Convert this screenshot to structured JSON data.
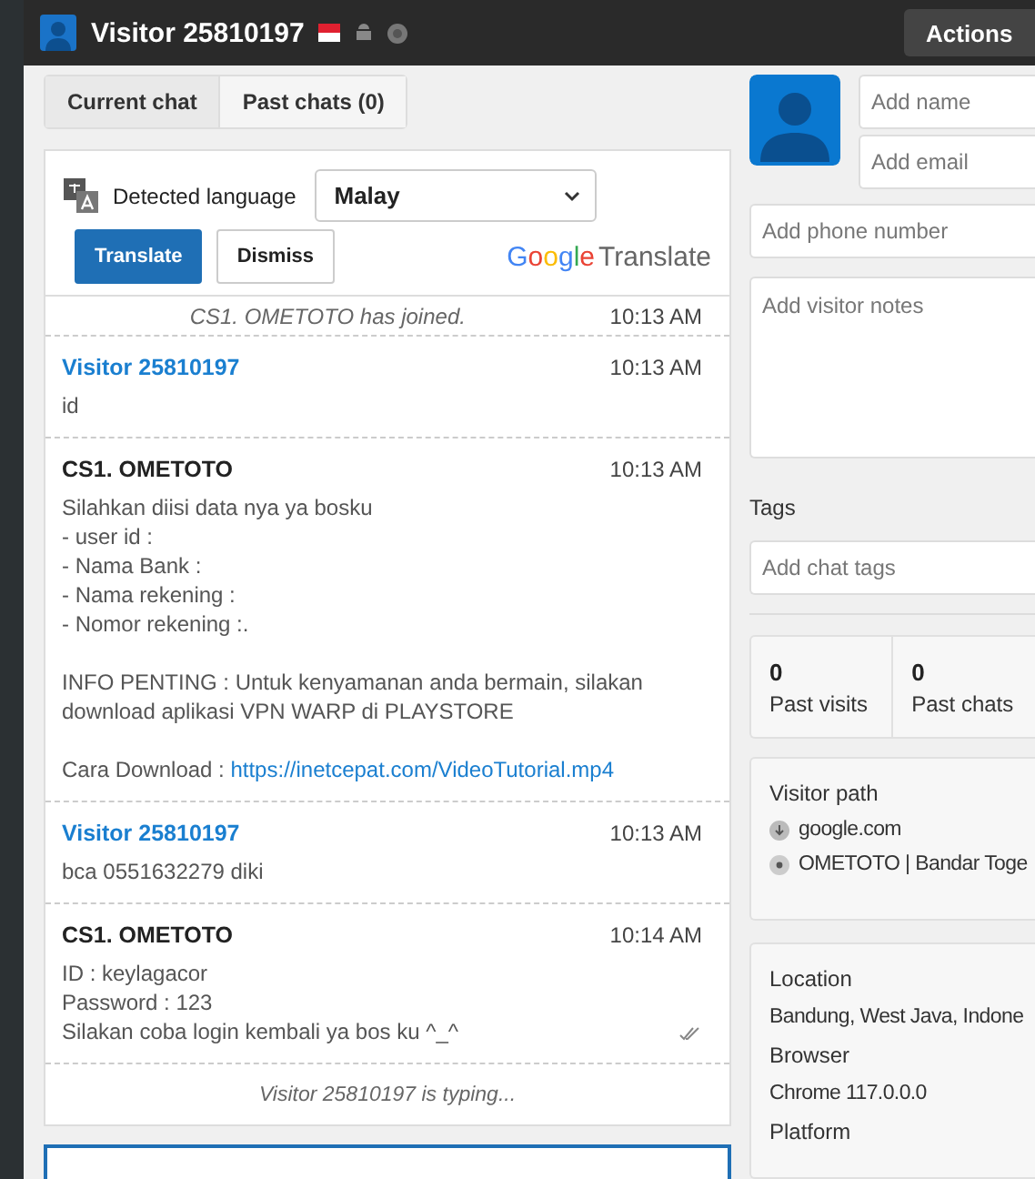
{
  "header": {
    "title": "Visitor 25810197",
    "actions": "Actions"
  },
  "tabs": [
    {
      "label": "Current chat",
      "selected": true
    },
    {
      "label": "Past chats (0)",
      "selected": false
    }
  ],
  "translate": {
    "label": "Detected language",
    "language": "Malay",
    "primary": "Translate",
    "secondary": "Dismiss",
    "brand_name": "Google",
    "brand_product": "Translate"
  },
  "messages": [
    {
      "kind": "system",
      "text": "CS1. OMETOTO has joined.",
      "time": "10:13 AM"
    },
    {
      "kind": "visitor",
      "author": "Visitor 25810197",
      "time": "10:13 AM",
      "body": "id"
    },
    {
      "kind": "agent",
      "author": "CS1. OMETOTO",
      "time": "10:13 AM",
      "body": "Silahkan diisi data nya ya bosku\n- user id :\n- Nama Bank :\n- Nama rekening :\n- Nomor rekening :.\n\nINFO PENTING : Untuk kenyamanan anda bermain, silakan download aplikasi VPN WARP di PLAYSTORE\n\nCara Download : ",
      "link": "https://inetcepat.com/VideoTutorial.mp4",
      "read": false
    },
    {
      "kind": "visitor",
      "author": "Visitor 25810197",
      "time": "10:13 AM",
      "body": "bca 0551632279 diki"
    },
    {
      "kind": "agent",
      "author": "CS1. OMETOTO",
      "time": "10:14 AM",
      "body": "ID : keylagacor\nPassword : 123\nSilakan coba login kembali ya bos ku ^_^",
      "read": true
    }
  ],
  "typing": "Visitor 25810197 is typing...",
  "visitor": {
    "name_placeholder": "Add name",
    "email_placeholder": "Add email",
    "phone_placeholder": "Add phone number",
    "notes_placeholder": "Add visitor notes",
    "tags_label": "Tags",
    "tags_placeholder": "Add chat tags"
  },
  "stats": [
    {
      "value": "0",
      "label": "Past visits"
    },
    {
      "value": "0",
      "label": "Past chats"
    }
  ],
  "visitor_path": {
    "title": "Visitor path",
    "items": [
      {
        "kind": "referrer",
        "text": "google.com"
      },
      {
        "kind": "page",
        "text": "OMETOTO | Bandar Toge"
      }
    ]
  },
  "details": [
    {
      "label": "Location",
      "value": "Bandung, West Java, Indone"
    },
    {
      "label": "Browser",
      "value": "Chrome 117.0.0.0"
    },
    {
      "label": "Platform"
    }
  ]
}
